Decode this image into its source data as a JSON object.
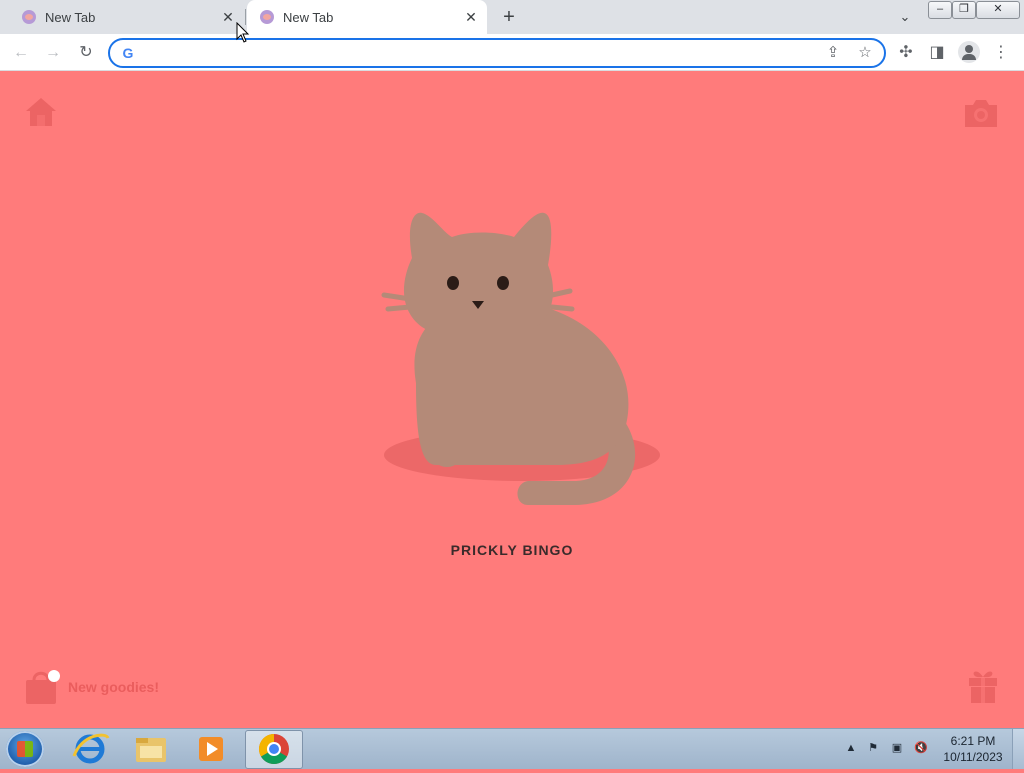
{
  "browser": {
    "tabs": [
      {
        "title": "New Tab",
        "active": false
      },
      {
        "title": "New Tab",
        "active": true
      }
    ],
    "new_tab_label": "+",
    "address_bar": {
      "value": "",
      "placeholder": ""
    },
    "accent_color": "#1a73e8"
  },
  "page": {
    "background_color": "#ff7b7b",
    "cat_name": "PRICKLY BINGO",
    "goodies_label": "New goodies!",
    "icons": {
      "top_left": "home-icon",
      "top_right": "camera-icon",
      "bottom_left": "shopping-bag-icon",
      "bottom_right": "gift-icon"
    }
  },
  "taskbar": {
    "time": "6:21 PM",
    "date": "10/11/2023",
    "apps": [
      "internet-explorer",
      "windows-explorer",
      "media-player",
      "google-chrome"
    ]
  }
}
